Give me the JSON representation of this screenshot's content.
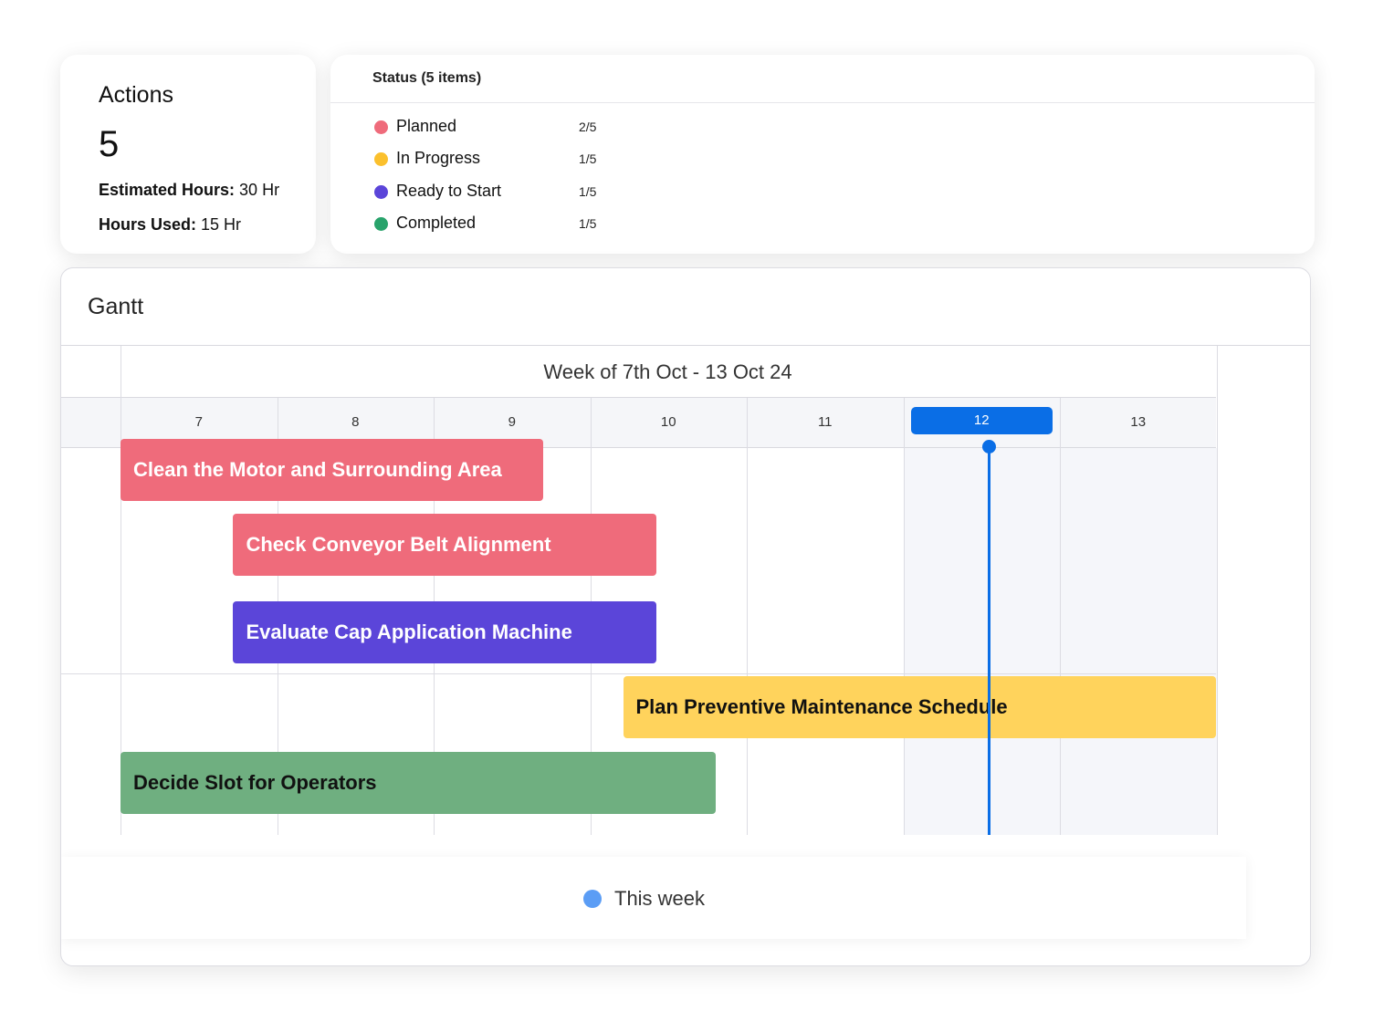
{
  "actions": {
    "title": "Actions",
    "count": "5",
    "estimated_hours_label": "Estimated Hours:",
    "estimated_hours_value": "30 Hr",
    "hours_used_label": "Hours Used:",
    "hours_used_value": "15 Hr"
  },
  "status": {
    "title": "Status (5 items)",
    "items": [
      {
        "label": "Planned",
        "count": "2/5",
        "color": "#ef6b7b"
      },
      {
        "label": "In Progress",
        "count": "1/5",
        "color": "#fbc02d"
      },
      {
        "label": "Ready to Start",
        "count": "1/5",
        "color": "#5b45d9"
      },
      {
        "label": "Completed",
        "count": "1/5",
        "color": "#28a36b"
      }
    ]
  },
  "gantt": {
    "title": "Gantt",
    "week_label": "Week  of 7th Oct - 13 Oct 24",
    "days": [
      "7",
      "8",
      "9",
      "10",
      "11",
      "12",
      "13"
    ],
    "current_day": "12",
    "legend_label": "This week",
    "legend_color": "#5b9df5"
  },
  "chart_data": {
    "type": "gantt",
    "unit": "day of October 2024",
    "tasks": [
      {
        "name": "Clean the Motor and Surrounding Area",
        "start": 7.0,
        "end": 9.7,
        "row": 0,
        "color": "#ef6b7b",
        "text_color": "#ffffff"
      },
      {
        "name": "Check Conveyor Belt Alignment",
        "start": 7.72,
        "end": 10.42,
        "row": 1,
        "color": "#ef6b7b",
        "text_color": "#ffffff"
      },
      {
        "name": "Evaluate Cap Application Machine",
        "start": 7.72,
        "end": 10.42,
        "row": 2,
        "color": "#5b45d9",
        "text_color": "#ffffff"
      },
      {
        "name": "Plan Preventive Maintenance Schedule",
        "start": 10.21,
        "end": 14.0,
        "row": 3,
        "color": "#ffd35c",
        "text_color": "#111111"
      },
      {
        "name": "Decide Slot for Operators",
        "start": 7.0,
        "end": 10.8,
        "row": 4,
        "color": "#6faf80",
        "text_color": "#111111"
      }
    ],
    "today": 12.55
  }
}
